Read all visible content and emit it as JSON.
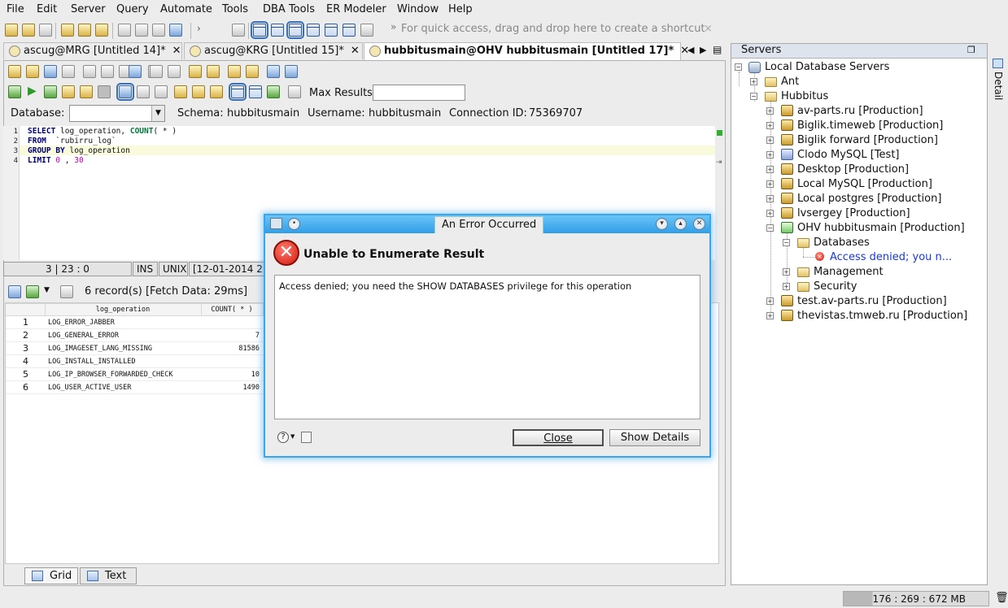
{
  "menu": [
    "File",
    "Edit",
    "Server",
    "Query",
    "Automate",
    "Tools",
    "DBA Tools",
    "ER Modeler",
    "Window",
    "Help"
  ],
  "menu_mnemonic": [
    "F",
    "E",
    "S",
    "Q",
    "A",
    "T",
    "D",
    "E",
    "W",
    "H"
  ],
  "toolbar": {
    "shortcut_hint": "For quick access, drag and drop here to create a shortcut",
    "shortcut_close": "×"
  },
  "tabs": [
    {
      "label": "ascug@MRG [Untitled 14]*",
      "close": "✕"
    },
    {
      "label": "ascug@KRG [Untitled 15]*",
      "close": "✕"
    },
    {
      "label": "hubbitusmain@OHV hubbitusmain [Untitled 17]*",
      "close": "✕"
    }
  ],
  "query_toolbar": {
    "max_results_label": "Max Results:",
    "max_results_value": ""
  },
  "connection": {
    "database_label": "Database:",
    "database_value": "",
    "schema_label": "Schema:",
    "schema_value": "hubbitusmain",
    "username_label": "Username:",
    "username_value": "hubbitusmain",
    "connection_id_label": "Connection ID:",
    "connection_id_value": "75369707"
  },
  "editor": {
    "line_numbers": [
      "1",
      "2",
      "3",
      "4"
    ],
    "lines": [
      [
        {
          "t": "SELECT",
          "c": "kw"
        },
        {
          "t": " log_operation, ",
          "c": ""
        },
        {
          "t": "COUNT",
          "c": "fn"
        },
        {
          "t": "( * )",
          "c": ""
        }
      ],
      [
        {
          "t": "FROM",
          "c": "kw"
        },
        {
          "t": "  `rubirru_log`",
          "c": ""
        }
      ],
      [
        {
          "t": "GROUP BY",
          "c": "kw"
        },
        {
          "t": " log_operation",
          "c": ""
        }
      ],
      [
        {
          "t": "LIMIT",
          "c": "kw"
        },
        {
          "t": " ",
          "c": ""
        },
        {
          "t": "0",
          "c": "num"
        },
        {
          "t": " , ",
          "c": ""
        },
        {
          "t": "30",
          "c": "num"
        }
      ]
    ]
  },
  "editor_status": {
    "position": "3 | 23 : 0",
    "mode": "INS",
    "line_ending": "UNIX",
    "timestamp": "[12-01-2014 2"
  },
  "results": {
    "summary": "6 record(s) [Fetch Data: 29ms]",
    "columns": [
      "log_operation",
      "COUNT( * )"
    ],
    "rows": [
      {
        "n": "1",
        "op": "LOG_ERROR_JABBER",
        "count": ""
      },
      {
        "n": "2",
        "op": "LOG_GENERAL_ERROR",
        "count": "7"
      },
      {
        "n": "3",
        "op": "LOG_IMAGESET_LANG_MISSING",
        "count": "81586"
      },
      {
        "n": "4",
        "op": "LOG_INSTALL_INSTALLED",
        "count": ""
      },
      {
        "n": "5",
        "op": "LOG_IP_BROWSER_FORWARDED_CHECK",
        "count": "10"
      },
      {
        "n": "6",
        "op": "LOG_USER_ACTIVE_USER",
        "count": "1490"
      }
    ]
  },
  "bottom_tabs": [
    "Grid",
    "Text"
  ],
  "servers": {
    "title": "Servers",
    "detail_label": "Detail",
    "root": "Local Database Servers",
    "groups": [
      {
        "label": "Ant"
      },
      {
        "label": "Hubbitus"
      }
    ],
    "hubbitus_children": [
      {
        "label": "av-parts.ru [Production]",
        "icon": "srv"
      },
      {
        "label": "Biglik.timeweb [Production]",
        "icon": "srv"
      },
      {
        "label": "Biglik forward [Production]",
        "icon": "srv"
      },
      {
        "label": "Clodo MySQL [Test]",
        "icon": "srvt"
      },
      {
        "label": "Desktop [Production]",
        "icon": "srv"
      },
      {
        "label": "Local MySQL [Production]",
        "icon": "srv"
      },
      {
        "label": "Local postgres [Production]",
        "icon": "srv"
      },
      {
        "label": "lvsergey [Production]",
        "icon": "srv"
      },
      {
        "label": "OHV hubbitusmain [Production]",
        "icon": "srvg"
      }
    ],
    "ohv_children": [
      "Databases",
      "Management",
      "Security"
    ],
    "databases_error": "Access denied; you n...",
    "after": [
      {
        "label": "test.av-parts.ru [Production]"
      },
      {
        "label": "thevistas.tmweb.ru [Production]"
      }
    ]
  },
  "memory_status": "176 : 269 : 672 MB",
  "dialog": {
    "title": "An Error Occurred",
    "heading": "Unable to Enumerate Result",
    "message": "Access denied; you need the SHOW DATABASES privilege for this operation",
    "close_label": "Close",
    "details_label": "Show Details",
    "min_glyph": "▾",
    "max_glyph": "▴",
    "close_glyph": "✕"
  },
  "colors": {
    "dialog_accent": "#39a7ea",
    "keyword": "#00007a",
    "function": "#007a3a",
    "number": "#c000c0",
    "error_link": "#1a3ad6"
  }
}
